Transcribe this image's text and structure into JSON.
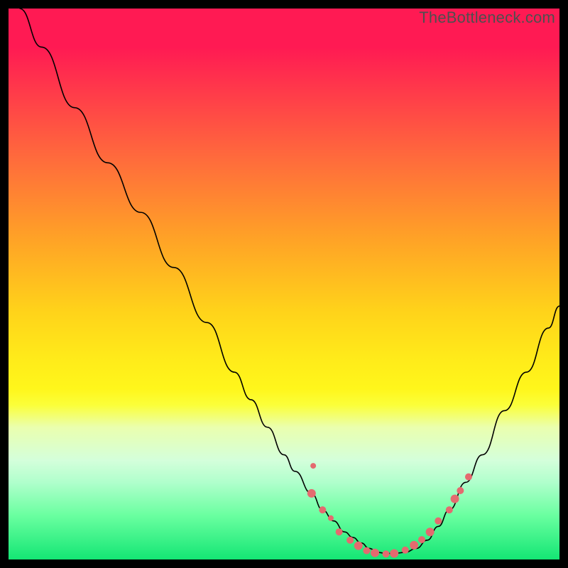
{
  "watermark": "TheBottleneck.com",
  "chart_data": {
    "type": "line",
    "title": "",
    "xlabel": "",
    "ylabel": "",
    "xlim": [
      0,
      100
    ],
    "ylim": [
      0,
      100
    ],
    "series": [
      {
        "name": "bottleneck-curve",
        "x": [
          2,
          6,
          12,
          18,
          24,
          30,
          36,
          41,
          44,
          47,
          50,
          52,
          55,
          57,
          59,
          61,
          62.5,
          64,
          65.5,
          67,
          68.5,
          70,
          72,
          74,
          76,
          78,
          80,
          83,
          86,
          90,
          94,
          98,
          100
        ],
        "y": [
          100,
          93,
          82,
          72,
          63,
          53,
          43,
          34,
          29,
          24,
          19,
          16,
          12,
          9,
          7,
          5,
          4,
          3,
          2,
          1.3,
          1.1,
          1.1,
          1.3,
          2,
          3.5,
          6,
          9,
          14,
          19,
          27,
          34,
          42,
          46
        ]
      }
    ],
    "markers": {
      "name": "highlight-dots",
      "points": [
        {
          "x": 55,
          "y": 12,
          "r": 6
        },
        {
          "x": 55.3,
          "y": 17,
          "r": 4
        },
        {
          "x": 57,
          "y": 9,
          "r": 5
        },
        {
          "x": 58.5,
          "y": 7.5,
          "r": 4
        },
        {
          "x": 60,
          "y": 5,
          "r": 5
        },
        {
          "x": 62,
          "y": 3.5,
          "r": 5
        },
        {
          "x": 63.5,
          "y": 2.5,
          "r": 6
        },
        {
          "x": 65,
          "y": 1.6,
          "r": 5
        },
        {
          "x": 66.5,
          "y": 1.2,
          "r": 6
        },
        {
          "x": 68.5,
          "y": 1.0,
          "r": 5
        },
        {
          "x": 70,
          "y": 1.1,
          "r": 6
        },
        {
          "x": 72,
          "y": 1.7,
          "r": 5
        },
        {
          "x": 73.6,
          "y": 2.6,
          "r": 6
        },
        {
          "x": 75,
          "y": 3.6,
          "r": 5
        },
        {
          "x": 76.5,
          "y": 5,
          "r": 6
        },
        {
          "x": 78,
          "y": 7,
          "r": 5
        },
        {
          "x": 80,
          "y": 9,
          "r": 5
        },
        {
          "x": 81,
          "y": 11,
          "r": 6
        },
        {
          "x": 82,
          "y": 12.5,
          "r": 5
        },
        {
          "x": 83.5,
          "y": 15,
          "r": 5
        }
      ]
    }
  }
}
